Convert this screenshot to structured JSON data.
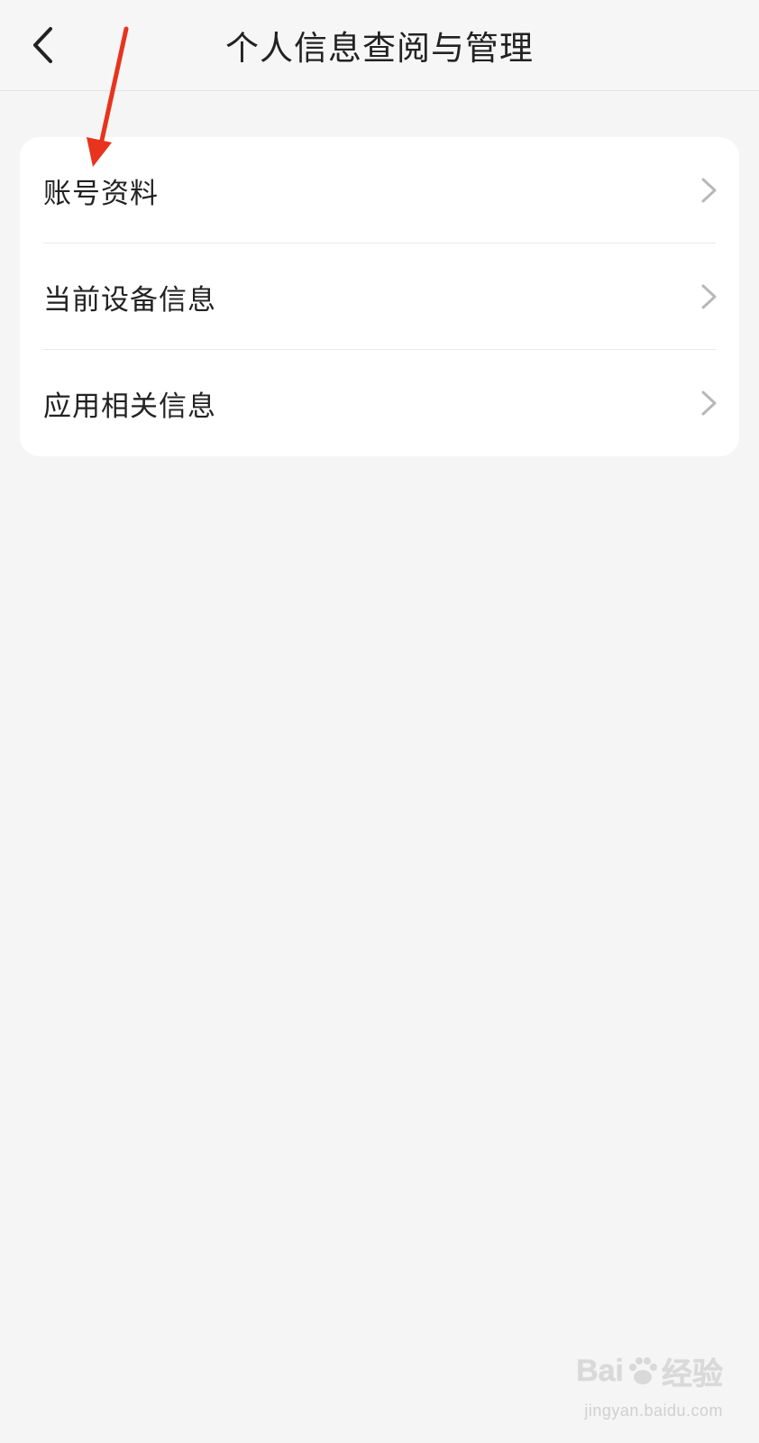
{
  "header": {
    "title": "个人信息查阅与管理",
    "back_icon": "chevron-left-icon"
  },
  "list": {
    "items": [
      {
        "label": "账号资料",
        "icon": "chevron-right-icon"
      },
      {
        "label": "当前设备信息",
        "icon": "chevron-right-icon"
      },
      {
        "label": "应用相关信息",
        "icon": "chevron-right-icon"
      }
    ]
  },
  "watermark": {
    "brand": "Bai",
    "brand_suffix": "经验",
    "site": "jingyan.baidu.com"
  },
  "colors": {
    "background": "#f5f5f5",
    "card": "#ffffff",
    "text": "#222222",
    "chevron": "#b8b8b8",
    "annotation": "#e8331e"
  }
}
